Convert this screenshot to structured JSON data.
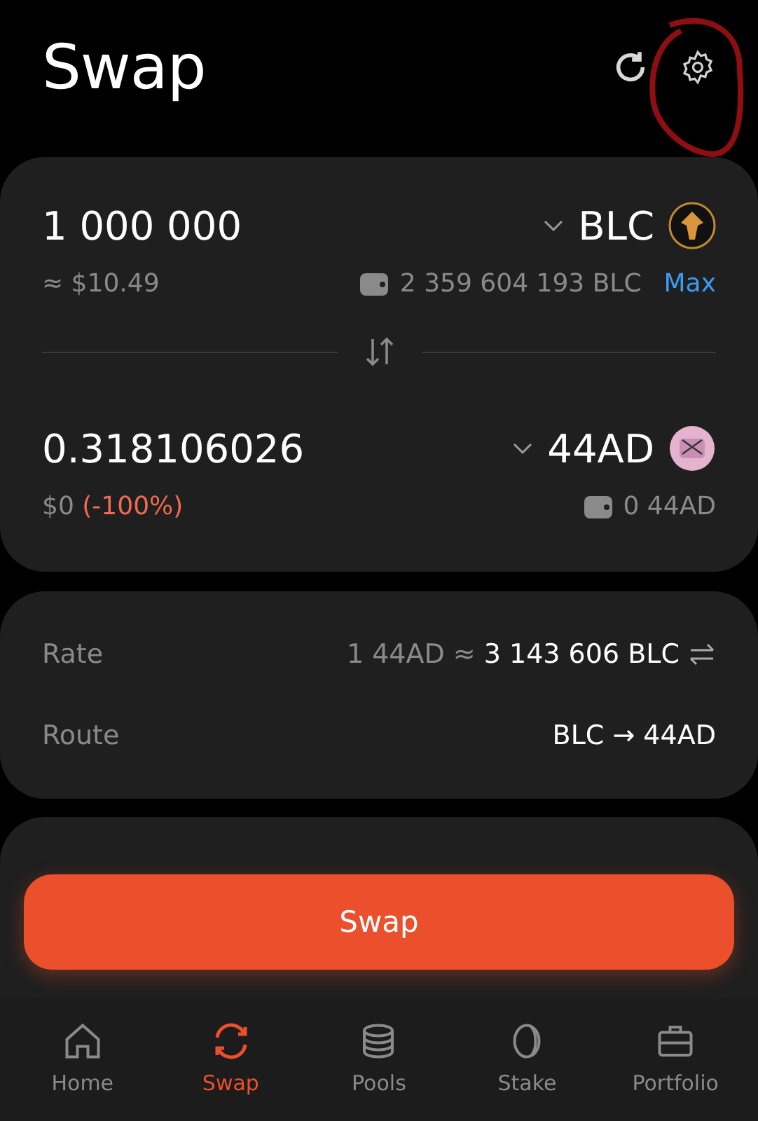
{
  "header": {
    "title": "Swap"
  },
  "from": {
    "amount": "1 000 000",
    "usd": "≈ $10.49",
    "token": "BLC",
    "balance": "2 359 604 193 BLC",
    "max": "Max"
  },
  "to": {
    "amount": "0.318106026",
    "usd": "$0",
    "change": "(-100%)",
    "token": "44AD",
    "balance": "0 44AD"
  },
  "details": [
    {
      "label": "Rate",
      "value": "1 44AD ≈ ",
      "strong": "3 143 606 BLC",
      "kind": "rate"
    },
    {
      "label": "Route",
      "value": "BLC → 44AD",
      "kind": "route"
    }
  ],
  "swap_button": "Swap",
  "nav": [
    {
      "label": "Home",
      "selected": false
    },
    {
      "label": "Swap",
      "selected": true
    },
    {
      "label": "Pools",
      "selected": false
    },
    {
      "label": "Stake",
      "selected": false
    },
    {
      "label": "Portfolio",
      "selected": false
    }
  ]
}
